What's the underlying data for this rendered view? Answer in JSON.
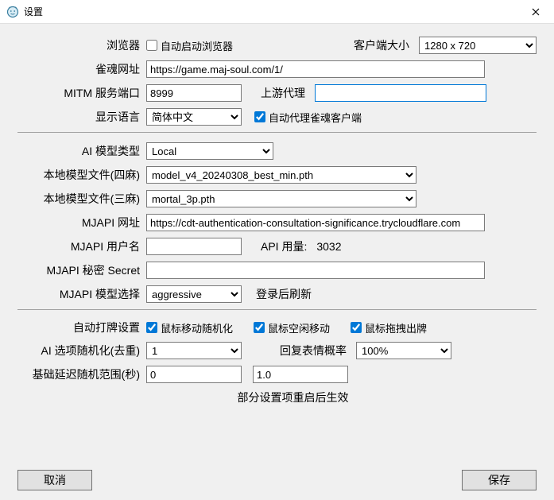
{
  "window": {
    "title": "设置"
  },
  "labels": {
    "browser": "浏览器",
    "auto_launch_browser": "自动启动浏览器",
    "client_size": "客户端大小",
    "majsoul_url": "雀魂网址",
    "mitm_port": "MITM 服务端口",
    "upstream_proxy": "上游代理",
    "display_lang": "显示语言",
    "auto_proxy_client": "自动代理雀魂客户端",
    "ai_model_type": "AI 模型类型",
    "local_model_4p": "本地模型文件(四麻)",
    "local_model_3p": "本地模型文件(三麻)",
    "mjapi_url": "MJAPI 网址",
    "mjapi_user": "MJAPI 用户名",
    "api_usage": "API 用量:",
    "mjapi_secret": "MJAPI 秘密 Secret",
    "mjapi_model_select": "MJAPI 模型选择",
    "refresh_after_login": "登录后刷新",
    "auto_play_settings": "自动打牌设置",
    "mouse_random": "鼠标移动随机化",
    "mouse_idle_move": "鼠标空闲移动",
    "mouse_drag_discard": "鼠标拖拽出牌",
    "ai_randomize": "AI 选项随机化(去重)",
    "reply_emoji_rate": "回复表情概率",
    "base_delay_range": "基础延迟随机范围(秒)",
    "note": "部分设置项重启后生效",
    "cancel": "取消",
    "save": "保存"
  },
  "values": {
    "client_size": "1280 x 720",
    "majsoul_url": "https://game.maj-soul.com/1/",
    "mitm_port": "8999",
    "upstream_proxy": "",
    "display_lang": "简体中文",
    "auto_launch_browser": false,
    "auto_proxy_client": true,
    "ai_model_type": "Local",
    "local_model_4p": "model_v4_20240308_best_min.pth",
    "local_model_3p": "mortal_3p.pth",
    "mjapi_url": "https://cdt-authentication-consultation-significance.trycloudflare.com",
    "mjapi_user": "",
    "api_usage": "3032",
    "mjapi_secret": "",
    "mjapi_model": "aggressive",
    "mouse_random": true,
    "mouse_idle_move": true,
    "mouse_drag_discard": true,
    "ai_randomize": "1",
    "reply_emoji_rate": "100%",
    "delay_min": "0",
    "delay_max": "1.0"
  }
}
